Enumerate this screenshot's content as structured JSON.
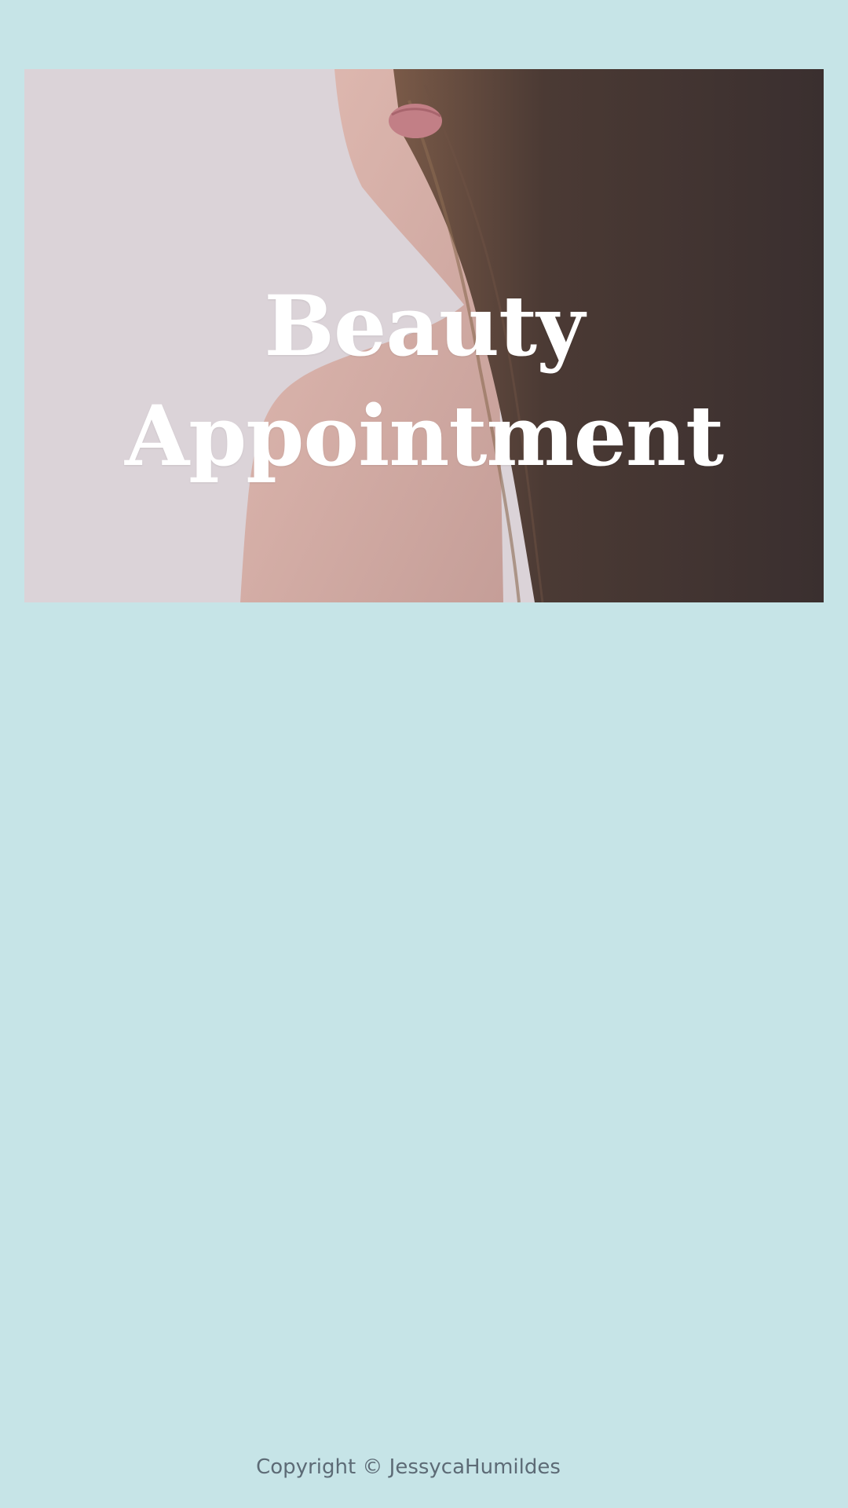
{
  "hero": {
    "title_line1": "Beauty",
    "title_line2": "Appointment",
    "image_alt": "woman-shoulder-hair-photo"
  },
  "footer": {
    "copyright": "Copyright © JessycaHumildes"
  },
  "colors": {
    "page_background": "#c6e4e7",
    "title_text": "#ffffff",
    "footer_text": "#5d6b76"
  }
}
